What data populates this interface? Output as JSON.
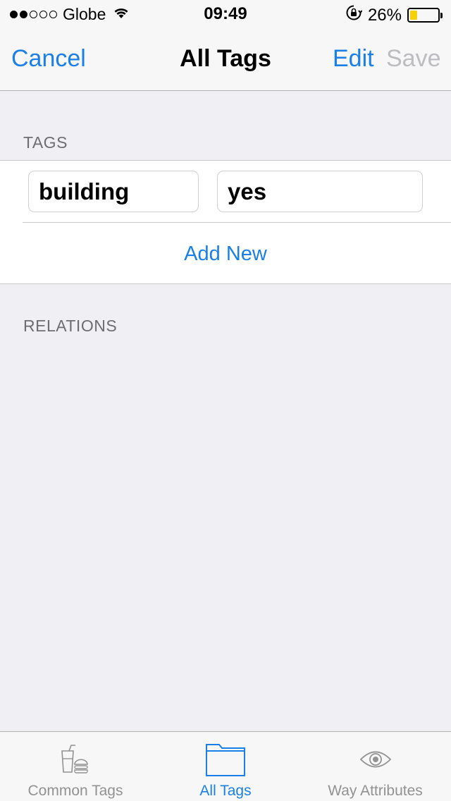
{
  "status_bar": {
    "carrier": "Globe",
    "time": "09:49",
    "battery_percent_text": "26%",
    "battery_level": 0.26,
    "signal_bars_filled": 2,
    "signal_bars_total": 5
  },
  "nav": {
    "cancel_label": "Cancel",
    "title": "All Tags",
    "edit_label": "Edit",
    "save_label": "Save"
  },
  "sections": {
    "tags_header": "TAGS",
    "relations_header": "RELATIONS"
  },
  "tags": [
    {
      "key": "building",
      "value": "yes"
    }
  ],
  "add_new_label": "Add New",
  "tab_bar": {
    "tabs": [
      {
        "label": "Common Tags",
        "icon": "food-icon",
        "active": false
      },
      {
        "label": "All Tags",
        "icon": "folder-icon",
        "active": true
      },
      {
        "label": "Way Attributes",
        "icon": "eye-icon",
        "active": false
      }
    ]
  },
  "colors": {
    "accent": "#1a7fe6",
    "disabled": "#bcbcc1",
    "background": "#efeff4",
    "battery_fill": "#f5d10a",
    "inactive_tab": "#929292"
  }
}
